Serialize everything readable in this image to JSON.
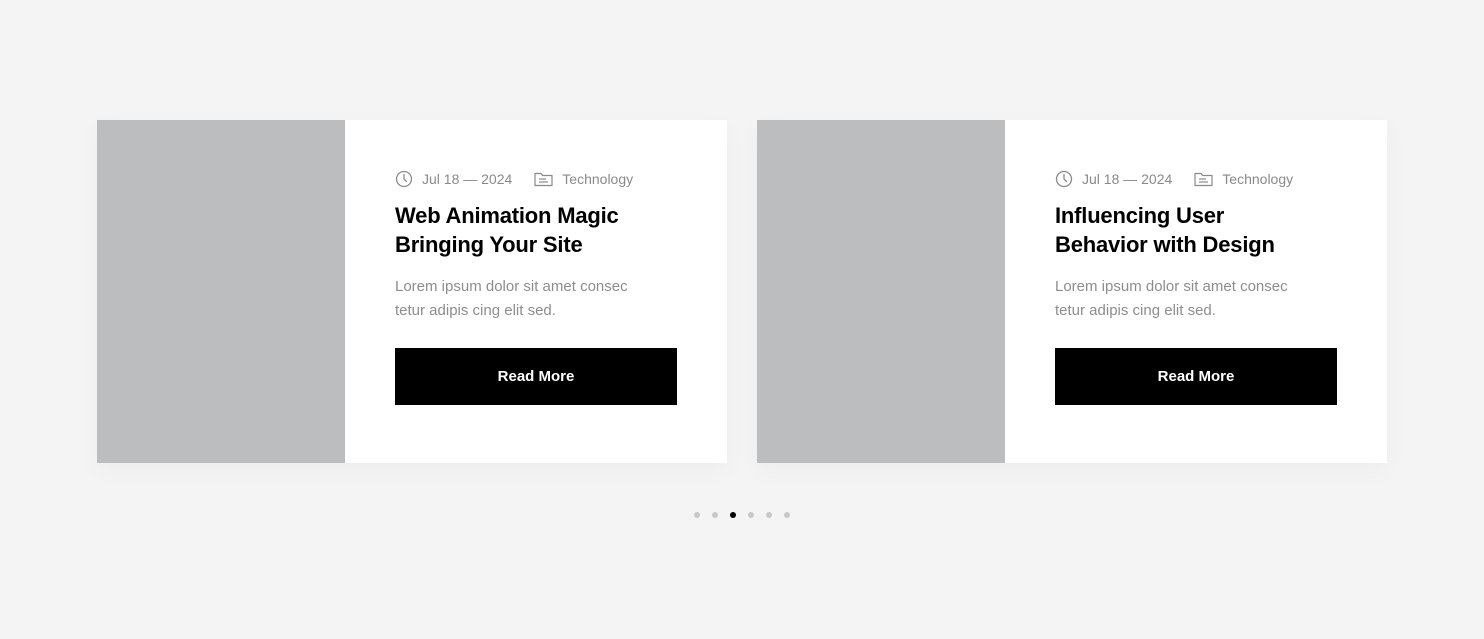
{
  "slider": {
    "cards": [
      {
        "date": "Jul 18 — 2024",
        "category": "Technology",
        "title": "Web Animation Magic Bringing Your Site",
        "excerpt": "Lorem ipsum dolor sit amet consec tetur adipis cing elit sed.",
        "button_label": "Read More"
      },
      {
        "date": "Jul 18 — 2024",
        "category": "Technology",
        "title": "Influencing User Behavior with Design",
        "excerpt": "Lorem ipsum dolor sit amet consec tetur adipis cing elit sed.",
        "button_label": "Read More"
      }
    ],
    "pagination": {
      "total": 6,
      "active_index": 2
    }
  },
  "icons": {
    "date": "clock-icon",
    "category": "folder-icon"
  },
  "colors": {
    "page_background": "#f4f4f4",
    "card_background": "#ffffff",
    "thumbnail_placeholder": "#bcbdbf",
    "button_background": "#000000",
    "button_text": "#ffffff",
    "meta_text": "#8a8a8a",
    "dot_inactive": "#c8c8c8",
    "dot_active": "#000000"
  }
}
